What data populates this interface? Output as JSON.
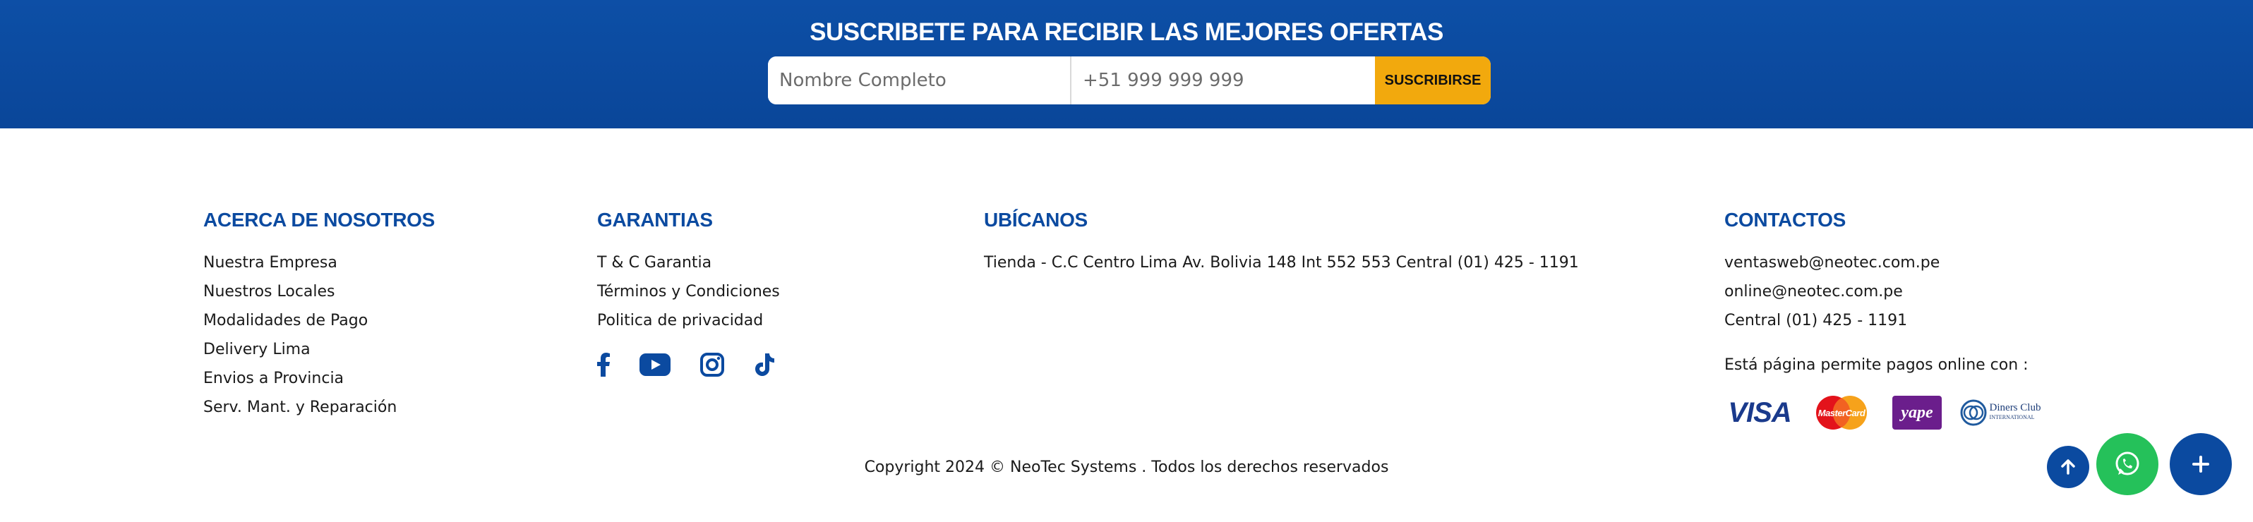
{
  "subscribe": {
    "title": "SUSCRIBETE PARA RECIBIR LAS MEJORES OFERTAS",
    "name_placeholder": "Nombre Completo",
    "phone_placeholder": "+51 999 999 999",
    "button_label": "SUSCRIBIRSE"
  },
  "about": {
    "heading": "ACERCA DE NOSOTROS",
    "links": [
      "Nuestra Empresa",
      "Nuestros Locales",
      "Modalidades de Pago",
      "Delivery Lima",
      "Envios a Provincia",
      "Serv. Mant. y Reparación"
    ]
  },
  "guarantees": {
    "heading": "GARANTIAS",
    "links": [
      "T & C Garantia",
      "Términos y Condiciones",
      "Politica de privacidad"
    ],
    "socials": [
      "facebook-icon",
      "youtube-icon",
      "instagram-icon",
      "tiktok-icon"
    ]
  },
  "location": {
    "heading": "UBÍCANOS",
    "address": "Tienda - C.C Centro Lima Av. Bolivia 148 Int 552 553 Central (01) 425 - 1191"
  },
  "contacts": {
    "heading": "CONTACTOS",
    "items": [
      "ventasweb@neotec.com.pe",
      "online@neotec.com.pe",
      "Central (01) 425 - 1191"
    ],
    "payments_text": "Está página permite pagos online con :",
    "cards": {
      "visa": "VISA",
      "mastercard": "MasterCard",
      "yape": "yape",
      "diners_line1": "Diners Club",
      "diners_line2": "INTERNATIONAL"
    }
  },
  "copyright": "Copyright 2024 © NeoTec Systems . Todos los derechos reservados",
  "colors": {
    "brand_blue": "#0b4aa0",
    "accent_yellow": "#f2a90d",
    "whatsapp_green": "#25c15a"
  }
}
